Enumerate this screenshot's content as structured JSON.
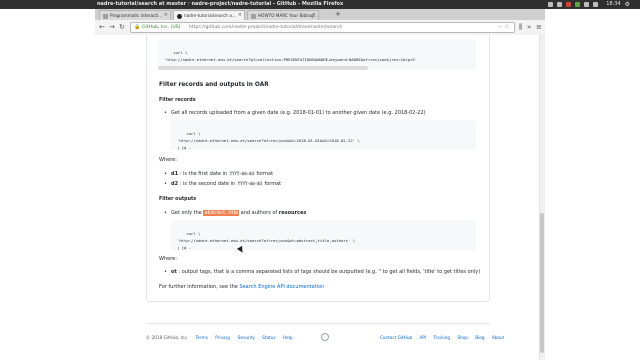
{
  "window": {
    "title": "nadre-tutorial/search at master · nadre-project/nadre-tutorial - GitHub - Mozilla Firefox",
    "clock": "18:34"
  },
  "tabs": [
    {
      "label": "Programmatic interacti...",
      "active": false
    },
    {
      "label": "nadre-tutorial/search a...",
      "active": true
    },
    {
      "label": "HOWTO MARC Your Bibliog...",
      "active": false
    }
  ],
  "navbar": {
    "site_identity": "GitHub, Inc. (US)",
    "url": "https://github.com/nadre-project/nadre-tutorial/tree/master/search",
    "new_tab": "+"
  },
  "content": {
    "code1": "curl \\\n'http://nadre.ethernet.edu.et/search?p1=collection:PRESENTATIONS&NADRE+keyword:NADRE&of=recjson&jrec=1&rg=5'\n| jq -",
    "section_title": "Filter records and outputs in OAR",
    "sub1": "Filter records",
    "bullet1": "Get all records uploaded from a given date (e.g. 2018-01-01) to another given date (e.g. 2018-02-22)",
    "code2": "curl \\\n'http://nadre.ethernet.edu.et/search?of=recjson&d1=2018-01-01&d2=2018-02-22' \\\n| jq -",
    "where1": "Where:",
    "d1": {
      "name": "d1",
      "text_a": ": is the first date in",
      "fmt": "YYYY-mm-dd",
      "text_b": "format"
    },
    "d2": {
      "name": "d2",
      "text_a": ": is the second date in",
      "fmt": "YYYY-mm-dd",
      "text_b": "format"
    },
    "sub2": "Filter outputs",
    "bullet2": {
      "pre": "Get only the",
      "hl": "abstract, title",
      "mid": "and authors of",
      "bold": "resources"
    },
    "code3": "curl \\\n'http://nadre.ethernet.edu.et/search?of=recjson&ot=abstract,title,authors' \\\n| jq -",
    "where2": "Where:",
    "ot": {
      "name": "ot",
      "text": ": output tags, that is a comma separated lists of tags should be outputted (e.g. '' to get all fields, 'title' to get titles only)"
    },
    "further": {
      "pre": "For further information, see the",
      "link": "Search Engine API documentation"
    }
  },
  "footer": {
    "copyright": "© 2018 GitHub, Inc.",
    "left_links": [
      "Terms",
      "Privacy",
      "Security",
      "Status",
      "Help"
    ],
    "right_links": [
      "Contact GitHub",
      "API",
      "Training",
      "Shop",
      "Blog",
      "About"
    ]
  }
}
